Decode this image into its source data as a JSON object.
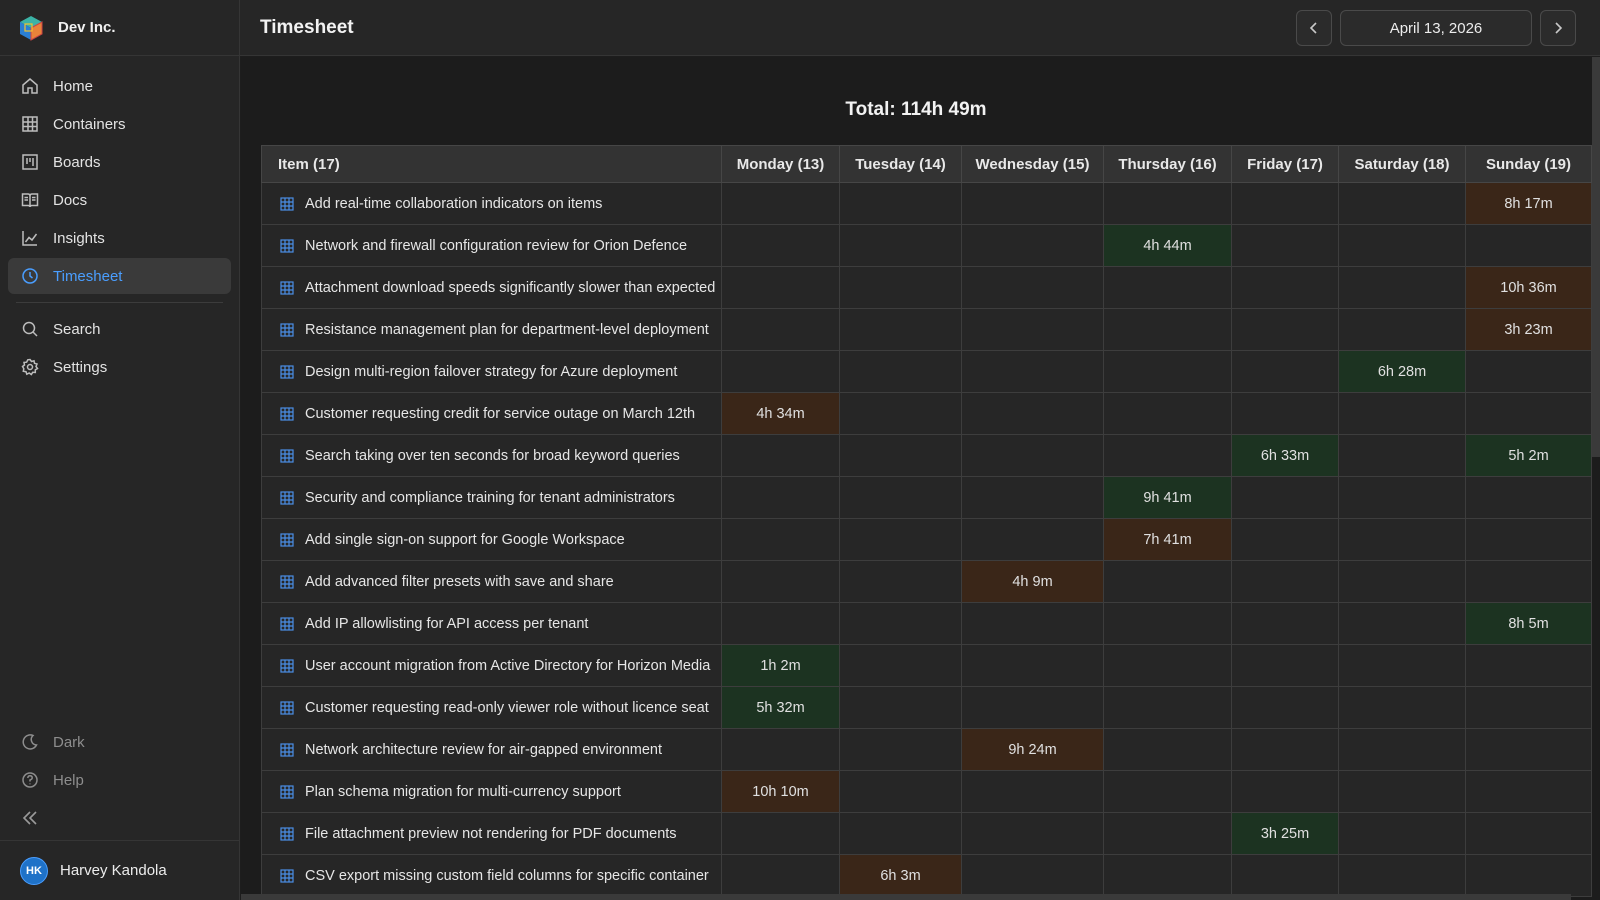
{
  "brand": {
    "name": "Dev Inc."
  },
  "sidebar": {
    "items": [
      {
        "label": "Home",
        "icon": "home-icon"
      },
      {
        "label": "Containers",
        "icon": "grid-icon"
      },
      {
        "label": "Boards",
        "icon": "board-icon"
      },
      {
        "label": "Docs",
        "icon": "docs-icon"
      },
      {
        "label": "Insights",
        "icon": "insights-icon"
      },
      {
        "label": "Timesheet",
        "icon": "clock-icon",
        "active": true
      },
      {
        "label": "Search",
        "icon": "search-icon"
      },
      {
        "label": "Settings",
        "icon": "gear-icon"
      }
    ],
    "bottom": [
      {
        "label": "Dark",
        "icon": "moon-icon"
      },
      {
        "label": "Help",
        "icon": "help-icon"
      }
    ]
  },
  "user": {
    "initials": "HK",
    "name": "Harvey Kandola"
  },
  "header": {
    "title": "Timesheet",
    "date": "April 13, 2026"
  },
  "timesheet": {
    "total": "Total: 114h 49m",
    "columns": [
      "Item (17)",
      "Monday (13)",
      "Tuesday (14)",
      "Wednesday (15)",
      "Thursday (16)",
      "Friday (17)",
      "Saturday (18)",
      "Sunday (19)"
    ],
    "rows": [
      {
        "item": "Add real-time collaboration indicators on items",
        "day": 6,
        "value": "8h 17m",
        "tone": "brown"
      },
      {
        "item": "Network and firewall configuration review for Orion Defence",
        "day": 3,
        "value": "4h 44m",
        "tone": "green"
      },
      {
        "item": "Attachment download speeds significantly slower than expected",
        "day": 6,
        "value": "10h 36m",
        "tone": "brown"
      },
      {
        "item": "Resistance management plan for department-level deployment",
        "day": 6,
        "value": "3h 23m",
        "tone": "brown"
      },
      {
        "item": "Design multi-region failover strategy for Azure deployment",
        "day": 5,
        "value": "6h 28m",
        "tone": "green"
      },
      {
        "item": "Customer requesting credit for service outage on March 12th",
        "day": 0,
        "value": "4h 34m",
        "tone": "brown"
      },
      {
        "item": "Search taking over ten seconds for broad keyword queries",
        "cells": [
          {
            "day": 4,
            "value": "6h 33m",
            "tone": "green"
          },
          {
            "day": 6,
            "value": "5h 2m",
            "tone": "green"
          }
        ]
      },
      {
        "item": "Security and compliance training for tenant administrators",
        "day": 3,
        "value": "9h 41m",
        "tone": "green"
      },
      {
        "item": "Add single sign-on support for Google Workspace",
        "day": 3,
        "value": "7h 41m",
        "tone": "brown"
      },
      {
        "item": "Add advanced filter presets with save and share",
        "day": 2,
        "value": "4h 9m",
        "tone": "brown"
      },
      {
        "item": "Add IP allowlisting for API access per tenant",
        "day": 6,
        "value": "8h 5m",
        "tone": "green"
      },
      {
        "item": "User account migration from Active Directory for Horizon Media",
        "day": 0,
        "value": "1h 2m",
        "tone": "green"
      },
      {
        "item": "Customer requesting read-only viewer role without licence seat",
        "day": 0,
        "value": "5h 32m",
        "tone": "green"
      },
      {
        "item": "Network architecture review for air-gapped environment",
        "day": 2,
        "value": "9h 24m",
        "tone": "brown"
      },
      {
        "item": "Plan schema migration for multi-currency support",
        "day": 0,
        "value": "10h 10m",
        "tone": "brown"
      },
      {
        "item": "File attachment preview not rendering for PDF documents",
        "day": 4,
        "value": "3h 25m",
        "tone": "green"
      },
      {
        "item": "CSV export missing custom field columns for specific container",
        "day": 1,
        "value": "6h 3m",
        "tone": "brown"
      }
    ]
  }
}
